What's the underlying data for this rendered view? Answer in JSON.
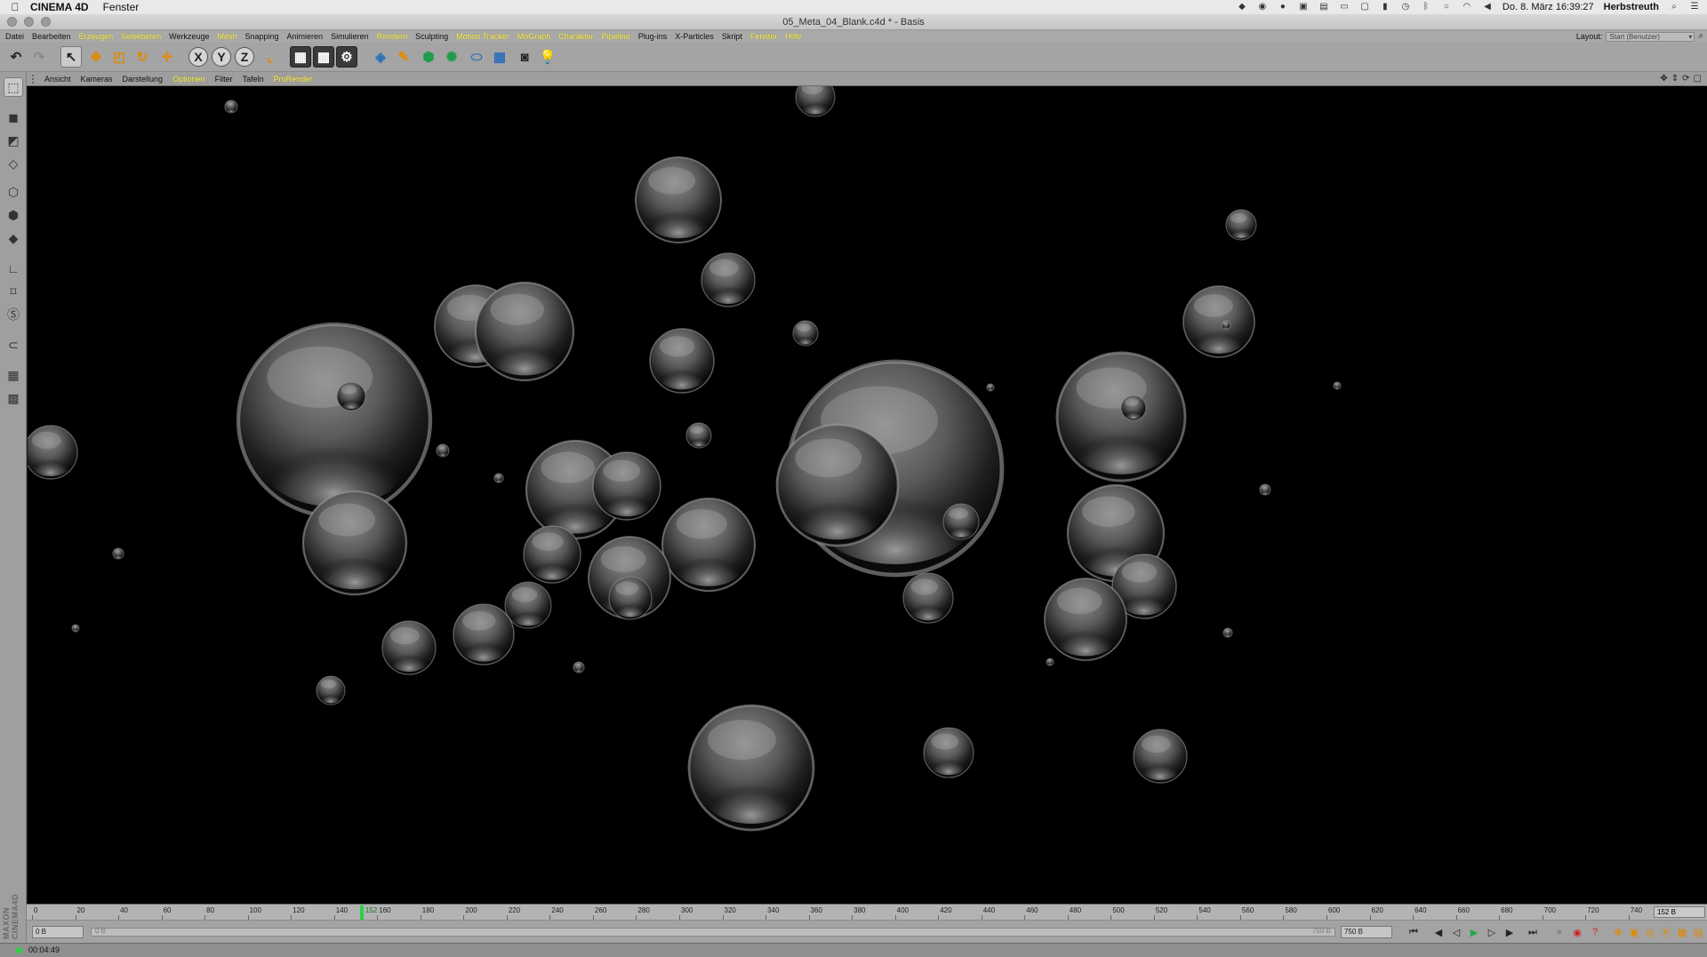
{
  "menubar": {
    "app_name": "CINEMA 4D",
    "items": [
      "Fenster"
    ],
    "clock": "Do. 8. März  16:39:27",
    "user": "Herbstreuth"
  },
  "window": {
    "title": "05_Meta_04_Blank.c4d * - Basis"
  },
  "main_menu": {
    "items": [
      {
        "label": "Datei",
        "highlight": false
      },
      {
        "label": "Bearbeiten",
        "highlight": false
      },
      {
        "label": "Erzeugen",
        "highlight": true
      },
      {
        "label": "Selektieren",
        "highlight": true
      },
      {
        "label": "Werkzeuge",
        "highlight": false
      },
      {
        "label": "Mesh",
        "highlight": true
      },
      {
        "label": "Snapping",
        "highlight": false
      },
      {
        "label": "Animieren",
        "highlight": false
      },
      {
        "label": "Simulieren",
        "highlight": false
      },
      {
        "label": "Rendern",
        "highlight": true
      },
      {
        "label": "Sculpting",
        "highlight": false
      },
      {
        "label": "Motion Tracker",
        "highlight": true
      },
      {
        "label": "MoGraph",
        "highlight": true
      },
      {
        "label": "Charakter",
        "highlight": true
      },
      {
        "label": "Pipeline",
        "highlight": true
      },
      {
        "label": "Plug-ins",
        "highlight": false
      },
      {
        "label": "X-Particles",
        "highlight": false
      },
      {
        "label": "Skript",
        "highlight": false
      },
      {
        "label": "Fenster",
        "highlight": true
      },
      {
        "label": "Hilfe",
        "highlight": true
      }
    ],
    "layout_label": "Layout:",
    "layout_value": "Start (Benutzer)"
  },
  "viewport_menu": {
    "items": [
      {
        "label": "Ansicht",
        "highlight": false
      },
      {
        "label": "Kameras",
        "highlight": false
      },
      {
        "label": "Darstellung",
        "highlight": false
      },
      {
        "label": "Optionen",
        "highlight": true
      },
      {
        "label": "Filter",
        "highlight": false
      },
      {
        "label": "Tafeln",
        "highlight": false
      },
      {
        "label": "ProRender",
        "highlight": true
      }
    ]
  },
  "toolbar": {
    "axis_x": "X",
    "axis_y": "Y",
    "axis_z": "Z"
  },
  "timeline": {
    "ticks": [
      0,
      20,
      40,
      60,
      80,
      100,
      120,
      140,
      160,
      180,
      200,
      220,
      240,
      260,
      280,
      300,
      320,
      340,
      360,
      380,
      400,
      420,
      440,
      460,
      480,
      500,
      520,
      540,
      560,
      580,
      600,
      620,
      640,
      660,
      680,
      700,
      720,
      740
    ],
    "min": 0,
    "max": 750,
    "current_frame": 152,
    "current_label": "152",
    "end_label": "152 B"
  },
  "transport": {
    "start_field": "0 B",
    "start_slider": "0 B",
    "end_slider": "750 B",
    "end_field": "750 B"
  },
  "status": {
    "render_time": "00:04:49"
  },
  "colors": {
    "menu_highlight": "#fff36a",
    "ui_gray": "#a4a4a4",
    "viewport_bg": "#000000",
    "timeline_cursor": "#2cd04a"
  }
}
